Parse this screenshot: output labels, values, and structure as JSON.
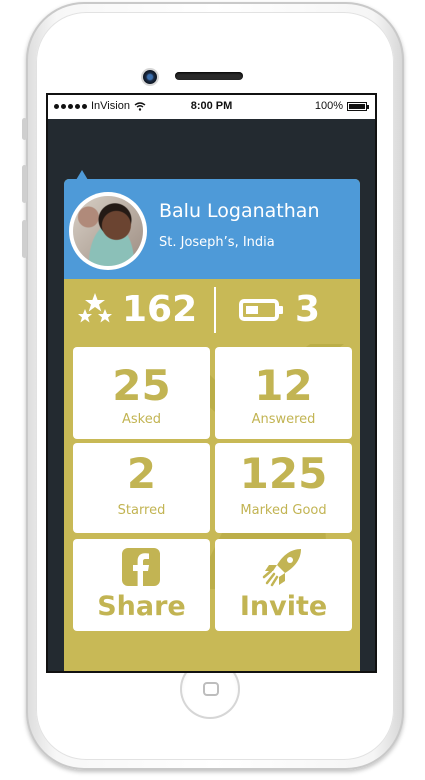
{
  "statusbar": {
    "carrier": "InVision",
    "time": "8:00 PM",
    "battery": "100%"
  },
  "profile": {
    "name": "Balu Loganathan",
    "location": "St. Joseph’s, India"
  },
  "stats": {
    "stars": "162",
    "battery_points": "3"
  },
  "tiles": [
    {
      "value": "25",
      "label": "Asked"
    },
    {
      "value": "12",
      "label": "Answered"
    },
    {
      "value": "2",
      "label": "Starred"
    },
    {
      "value": "125",
      "label": "Marked Good"
    }
  ],
  "actions": {
    "share": "Share",
    "invite": "Invite"
  },
  "colors": {
    "accent_gold": "#c8b956",
    "tile_text": "#c2b453",
    "profile_blue": "#4e9ad8",
    "screen_bg": "#232a30"
  },
  "icons": [
    "stars-icon",
    "battery-icon",
    "facebook-icon",
    "rocket-icon",
    "wifi-icon",
    "signal-dots-icon"
  ]
}
